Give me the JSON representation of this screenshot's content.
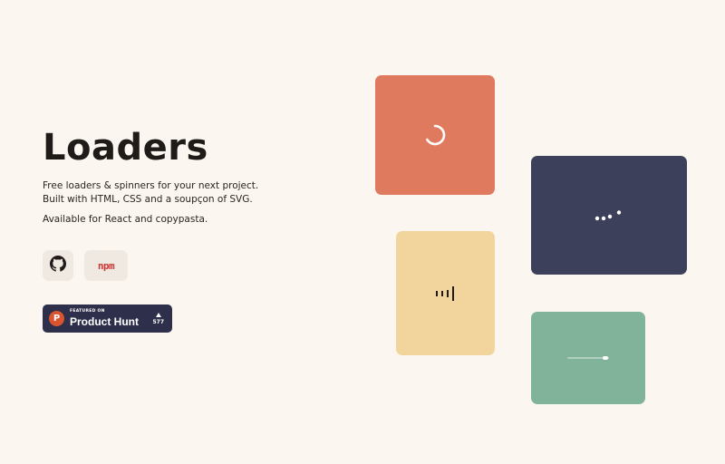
{
  "hero": {
    "title": "Loaders",
    "desc_line1": "Free loaders & spinners for your next project.",
    "desc_line2": "Built with HTML, CSS and a soupçon of SVG.",
    "availability": "Available for React and copypasta."
  },
  "links": {
    "github_icon": "github-icon",
    "npm_label": "npm"
  },
  "product_hunt": {
    "featured_label": "FEATURED ON",
    "name": "Product Hunt",
    "votes": "577",
    "logo_letter": "P"
  },
  "colors": {
    "background": "#fbf6ef",
    "card_orange": "#e07a5f",
    "card_navy": "#3d405b",
    "card_yellow": "#f2d49d",
    "card_green": "#81b29a",
    "npm_red": "#cb3837",
    "product_hunt_bg": "#2e2f4a",
    "product_hunt_orange": "#da552f"
  },
  "loaders": [
    {
      "name": "ring-spinner",
      "color": "#ffffff"
    },
    {
      "name": "bouncing-dots",
      "color": "#ffffff"
    },
    {
      "name": "bars-pulse",
      "color": "#1f1b19"
    },
    {
      "name": "progress-line",
      "color": "#ffffff"
    }
  ]
}
